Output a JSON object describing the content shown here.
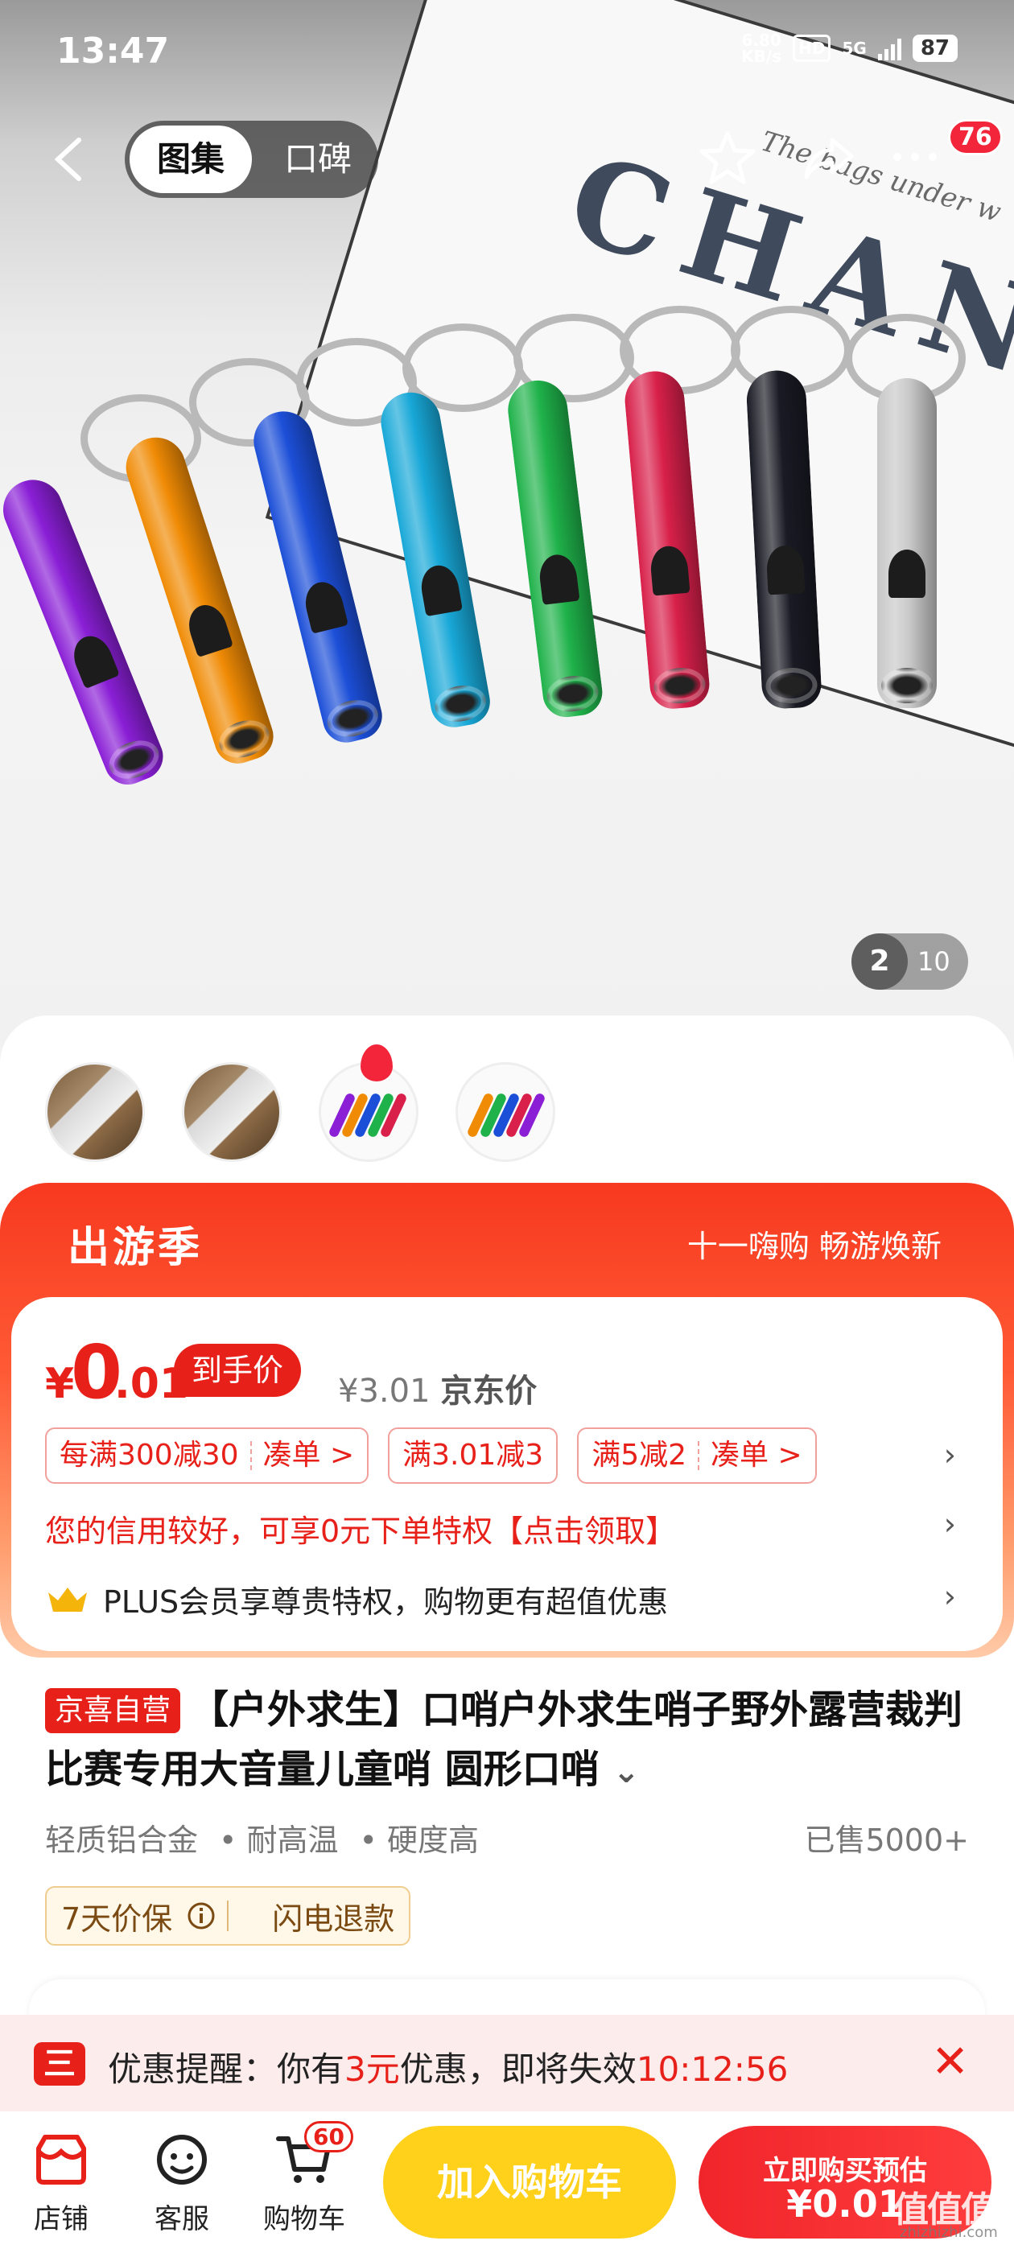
{
  "status_bar": {
    "time": "13:47",
    "net_speed": "6.80",
    "net_unit": "KB/s",
    "hd": "HD",
    "network": "5G",
    "battery": "87"
  },
  "nav": {
    "tab_gallery": "图集",
    "tab_reviews": "口碑",
    "more_badge": "76"
  },
  "hero": {
    "card_text": "CHAN",
    "card_subtext": "The bags under w",
    "page_current": "2",
    "page_total": "10",
    "whistle_colors": [
      "#8a1fd6",
      "#f08b05",
      "#1c4fd8",
      "#18a8d8",
      "#1fb24a",
      "#d8204a",
      "#1a1a24",
      "#c8c8c8"
    ]
  },
  "promo": {
    "title": "出游季",
    "subtitle": "十一嗨购 畅游焕新"
  },
  "price": {
    "currency": "¥",
    "integer": "0",
    "decimal": ".01",
    "arrive_tag": "到手价",
    "jd_price": "¥3.01",
    "jd_label": "京东价"
  },
  "coupons": [
    {
      "left": "每满300减30",
      "right": "凑单 >"
    },
    {
      "left": "满3.01减3",
      "right": ""
    },
    {
      "left": "满5减2",
      "right": "凑单 >"
    }
  ],
  "credit_text": "您的信用较好，可享0元下单特权【点击领取】",
  "plus_text": "PLUS会员享尊贵特权，购物更有超值优惠",
  "product": {
    "badge": "京喜自营",
    "title": "【户外求生】口哨户外求生哨子野外露营裁判比赛专用大音量儿童哨 圆形口哨",
    "expand": "⌄",
    "features": [
      "轻质铝合金",
      "• 耐高温",
      "• 硬度高"
    ],
    "sold": "已售5000+",
    "guarantee_1": "7天价保",
    "guarantee_2": "闪电退款"
  },
  "reminder": {
    "prefix": "优惠提醒：你有",
    "amount": "3元",
    "middle": "优惠，即将失效",
    "countdown": "10:12:56",
    "icon": "三"
  },
  "bottom": {
    "store": "店铺",
    "service": "客服",
    "cart": "购物车",
    "cart_count": "60",
    "add_cart": "加入购物车",
    "buy_line1": "立即购买预估",
    "buy_line2": "¥0.01"
  },
  "watermark": {
    "main": "值值值",
    "sub": "zhizhizhi.com"
  },
  "colors": {
    "accent_red": "#e8201a",
    "cart_yellow": "#ffd11a"
  },
  "icons": [
    "back-icon",
    "star-icon",
    "share-icon",
    "more-icon",
    "crown-icon",
    "info-icon",
    "close-icon",
    "store-icon",
    "service-icon",
    "cart-icon"
  ]
}
